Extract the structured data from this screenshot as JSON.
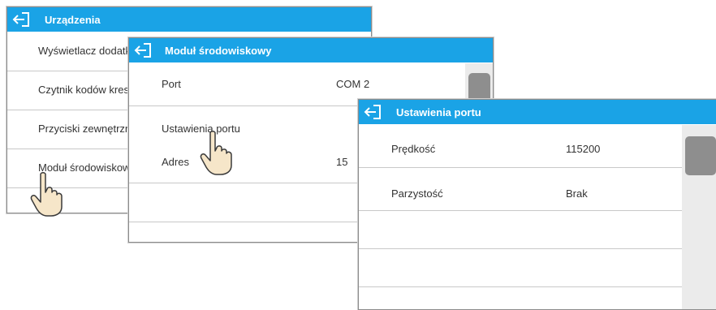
{
  "win1": {
    "title": "Urządzenia",
    "items": [
      "Wyświetlacz dodatkowy",
      "Czytnik kodów kreskowych",
      "Przyciski zewnętrzne",
      "Moduł środowiskowy"
    ]
  },
  "win2": {
    "title": "Moduł środowiskowy",
    "rows": [
      {
        "label": "Port",
        "value": "COM 2"
      },
      {
        "label": "Ustawienia portu",
        "value": ""
      },
      {
        "label": "Adres",
        "value": "15"
      }
    ]
  },
  "win3": {
    "title": "Ustawienia portu",
    "rows": [
      {
        "label": "Prędkość",
        "value": "115200"
      },
      {
        "label": "Parzystość",
        "value": "Brak"
      }
    ]
  },
  "icons": [
    "back-arrow-icon",
    "hand-pointer-icon"
  ],
  "colors": {
    "titlebar": "#1aa3e6",
    "scroll_thumb": "#8e8e8e",
    "scroll_track": "#ebebeb"
  }
}
